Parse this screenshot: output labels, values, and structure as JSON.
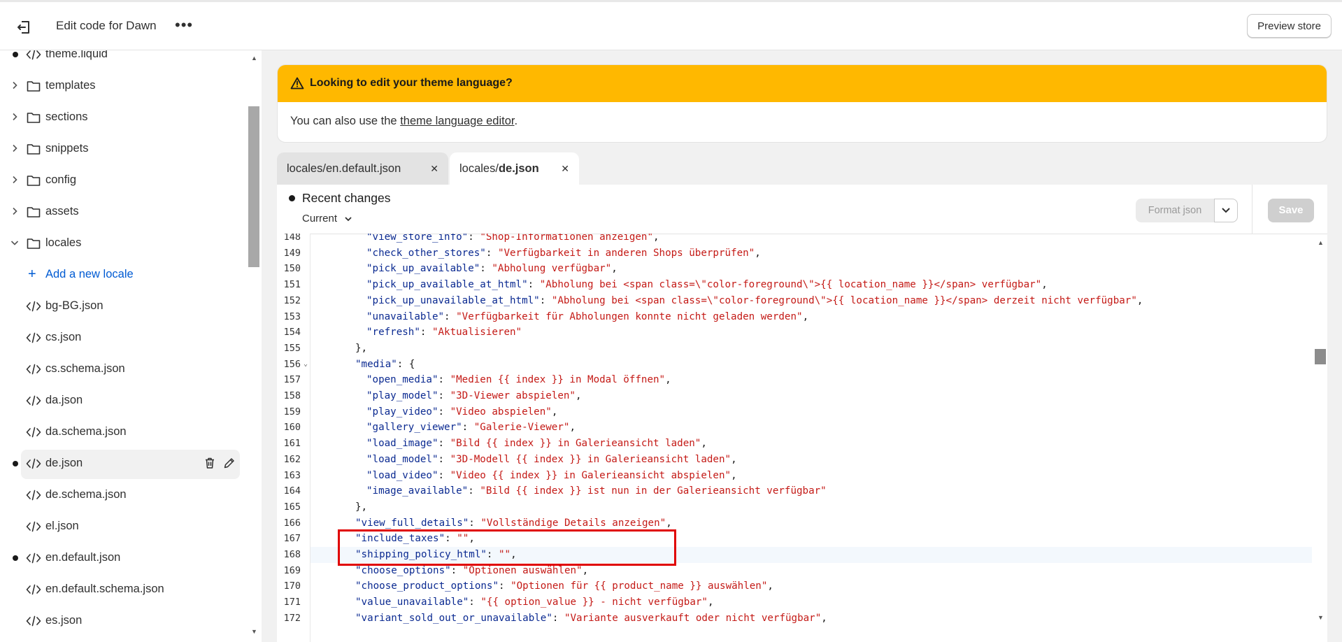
{
  "topbar": {
    "title": "Edit code for Dawn",
    "more": "•••",
    "preview_label": "Preview store"
  },
  "sidebar": {
    "items": [
      {
        "label": "theme.liquid",
        "kind": "file",
        "dot": true
      },
      {
        "label": "templates",
        "kind": "folder"
      },
      {
        "label": "sections",
        "kind": "folder"
      },
      {
        "label": "snippets",
        "kind": "folder"
      },
      {
        "label": "config",
        "kind": "folder"
      },
      {
        "label": "assets",
        "kind": "folder"
      },
      {
        "label": "locales",
        "kind": "folder-open"
      },
      {
        "label": "Add a new locale",
        "kind": "add"
      },
      {
        "label": "bg-BG.json",
        "kind": "file"
      },
      {
        "label": "cs.json",
        "kind": "file"
      },
      {
        "label": "cs.schema.json",
        "kind": "file"
      },
      {
        "label": "da.json",
        "kind": "file"
      },
      {
        "label": "da.schema.json",
        "kind": "file"
      },
      {
        "label": "de.json",
        "kind": "file",
        "dot": true,
        "selected": true
      },
      {
        "label": "de.schema.json",
        "kind": "file"
      },
      {
        "label": "el.json",
        "kind": "file"
      },
      {
        "label": "en.default.json",
        "kind": "file",
        "dot": true
      },
      {
        "label": "en.default.schema.json",
        "kind": "file"
      },
      {
        "label": "es.json",
        "kind": "file"
      }
    ]
  },
  "banner": {
    "title": "Looking to edit your theme language?",
    "body_prefix": "You can also use the ",
    "link": "theme language editor",
    "body_suffix": "."
  },
  "tabs": [
    {
      "prefix": "locales/",
      "name": "en.default.json",
      "active": false,
      "close": "✕"
    },
    {
      "prefix": "locales/",
      "name": "de.json",
      "active": true,
      "close": "✕"
    }
  ],
  "editor": {
    "recent_changes": "Recent changes",
    "current": "Current",
    "format_json": "Format json",
    "save": "Save"
  },
  "code_lines": [
    {
      "n": "148",
      "indent": 6,
      "key": "view_store_info",
      "val": "Shop-Informationen anzeigen",
      "end": ","
    },
    {
      "n": "149",
      "indent": 6,
      "key": "check_other_stores",
      "val": "Verfügbarkeit in anderen Shops überprüfen",
      "end": ","
    },
    {
      "n": "150",
      "indent": 6,
      "key": "pick_up_available",
      "val": "Abholung verfügbar",
      "end": ","
    },
    {
      "n": "151",
      "indent": 6,
      "key": "pick_up_available_at_html",
      "val": "Abholung bei <span class=\\\"color-foreground\\\">{{ location_name }}</span> verfügbar",
      "end": ","
    },
    {
      "n": "152",
      "indent": 6,
      "key": "pick_up_unavailable_at_html",
      "val": "Abholung bei <span class=\\\"color-foreground\\\">{{ location_name }}</span> derzeit nicht verfügbar",
      "end": ","
    },
    {
      "n": "153",
      "indent": 6,
      "key": "unavailable",
      "val": "Verfügbarkeit für Abholungen konnte nicht geladen werden",
      "end": ","
    },
    {
      "n": "154",
      "indent": 6,
      "key": "refresh",
      "val": "Aktualisieren",
      "end": ""
    },
    {
      "n": "155",
      "indent": 4,
      "raw": "},"
    },
    {
      "n": "156",
      "indent": 4,
      "key": "media",
      "open": ": {",
      "fold": true
    },
    {
      "n": "157",
      "indent": 6,
      "key": "open_media",
      "val": "Medien {{ index }} in Modal öffnen",
      "end": ","
    },
    {
      "n": "158",
      "indent": 6,
      "key": "play_model",
      "val": "3D-Viewer abspielen",
      "end": ","
    },
    {
      "n": "159",
      "indent": 6,
      "key": "play_video",
      "val": "Video abspielen",
      "end": ","
    },
    {
      "n": "160",
      "indent": 6,
      "key": "gallery_viewer",
      "val": "Galerie-Viewer",
      "end": ","
    },
    {
      "n": "161",
      "indent": 6,
      "key": "load_image",
      "val": "Bild {{ index }} in Galerieansicht laden",
      "end": ","
    },
    {
      "n": "162",
      "indent": 6,
      "key": "load_model",
      "val": "3D-Modell {{ index }} in Galerieansicht laden",
      "end": ","
    },
    {
      "n": "163",
      "indent": 6,
      "key": "load_video",
      "val": "Video {{ index }} in Galerieansicht abspielen",
      "end": ","
    },
    {
      "n": "164",
      "indent": 6,
      "key": "image_available",
      "val": "Bild {{ index }} ist nun in der Galerieansicht verfügbar",
      "end": ""
    },
    {
      "n": "165",
      "indent": 4,
      "raw": "},"
    },
    {
      "n": "166",
      "indent": 4,
      "key": "view_full_details",
      "val": "Vollständige Details anzeigen",
      "end": ","
    },
    {
      "n": "167",
      "indent": 4,
      "key": "include_taxes",
      "val": "",
      "end": ","
    },
    {
      "n": "168",
      "indent": 4,
      "key": "shipping_policy_html",
      "val": "",
      "end": ",",
      "highlight": true
    },
    {
      "n": "169",
      "indent": 4,
      "key": "choose_options",
      "val": "Optionen auswählen",
      "end": ","
    },
    {
      "n": "170",
      "indent": 4,
      "key": "choose_product_options",
      "val": "Optionen für {{ product_name }} auswählen",
      "end": ","
    },
    {
      "n": "171",
      "indent": 4,
      "key": "value_unavailable",
      "val": "{{ option_value }} - nicht verfügbar",
      "end": ","
    },
    {
      "n": "172",
      "indent": 4,
      "key": "variant_sold_out_or_unavailable",
      "val": "Variante ausverkauft oder nicht verfügbar",
      "end": ","
    }
  ],
  "colors": {
    "banner": "#ffb800",
    "link": "#005bd3",
    "code_key": "#0b2a91",
    "code_string": "#c41a16",
    "annotation": "#e00000"
  }
}
